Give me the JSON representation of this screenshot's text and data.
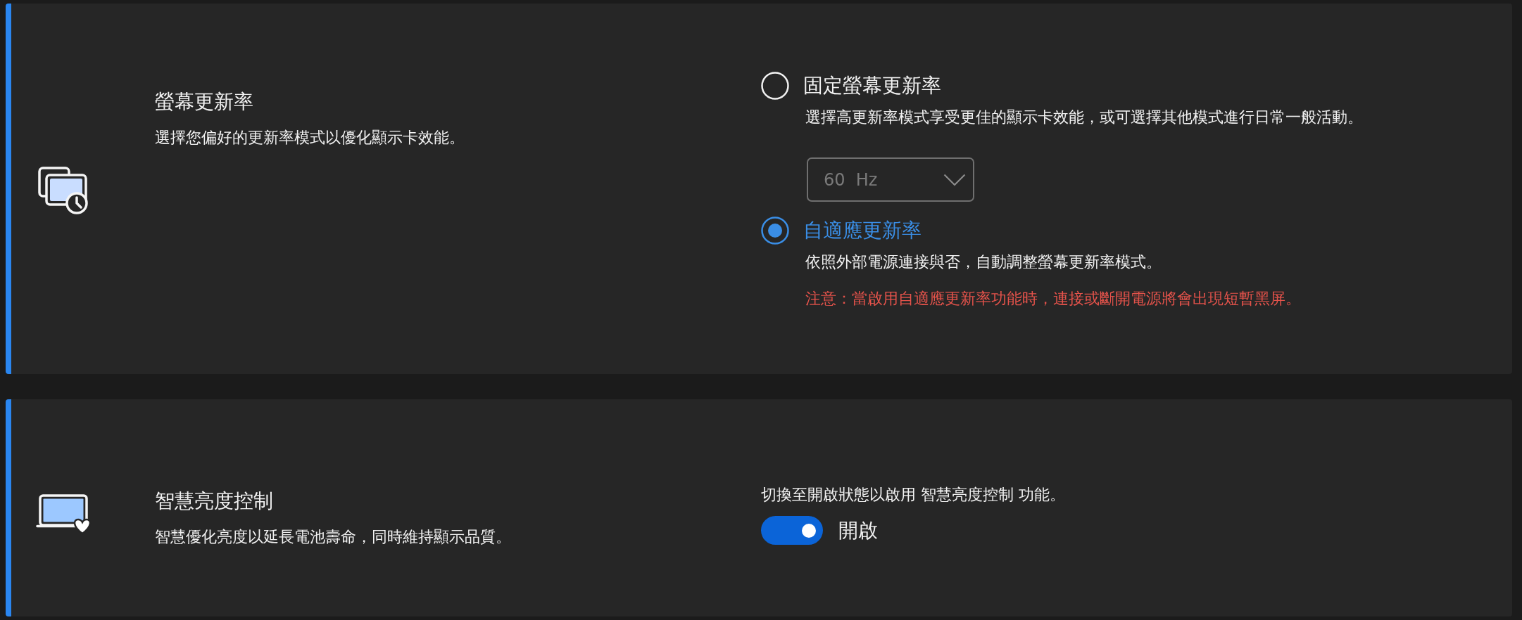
{
  "cards": [
    {
      "kind": "radio_options",
      "title": "螢幕更新率",
      "description": "選擇您偏好的更新率模式以優化顯示卡效能。",
      "options": [
        {
          "label": "固定螢幕更新率",
          "selected": false,
          "description": "選擇高更新率模式享受更佳的顯示卡效能，或可選擇其他模式進行日常一般活動。",
          "dropdown": {
            "value": "60  Hz",
            "disabled": true
          }
        },
        {
          "label": "自適應更新率",
          "selected": true,
          "description": "依照外部電源連接與否，自動調整螢幕更新率模式。",
          "warning": "注意：當啟用自適應更新率功能時，連接或斷開電源將會出現短暫黑屏。"
        }
      ]
    },
    {
      "kind": "toggle",
      "title": "智慧亮度控制",
      "description": "智慧優化亮度以延長電池壽命，同時維持顯示品質。",
      "hint": "切換至開啟狀態以啟用 智慧亮度控制 功能。",
      "toggle": {
        "on": true,
        "label": "開啟"
      }
    }
  ]
}
